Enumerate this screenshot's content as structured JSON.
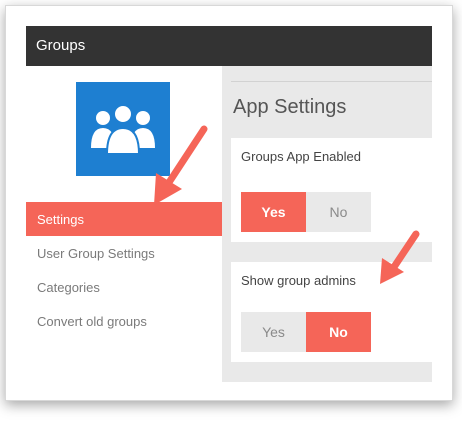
{
  "window": {
    "title": "Groups"
  },
  "sidebar": {
    "app_icon": "users-group-icon",
    "items": [
      {
        "label": "Settings",
        "active": true
      },
      {
        "label": "User Group Settings",
        "active": false
      },
      {
        "label": "Categories",
        "active": false
      },
      {
        "label": "Convert old groups",
        "active": false
      }
    ]
  },
  "main": {
    "title": "App Settings",
    "settings": [
      {
        "label": "Groups App Enabled",
        "options": [
          "Yes",
          "No"
        ],
        "selected": "Yes"
      },
      {
        "label": "Show group admins",
        "options": [
          "Yes",
          "No"
        ],
        "selected": "No"
      }
    ]
  },
  "colors": {
    "accent": "#f56558",
    "titlebar": "#333333",
    "app_icon_bg": "#1e7fd1"
  }
}
